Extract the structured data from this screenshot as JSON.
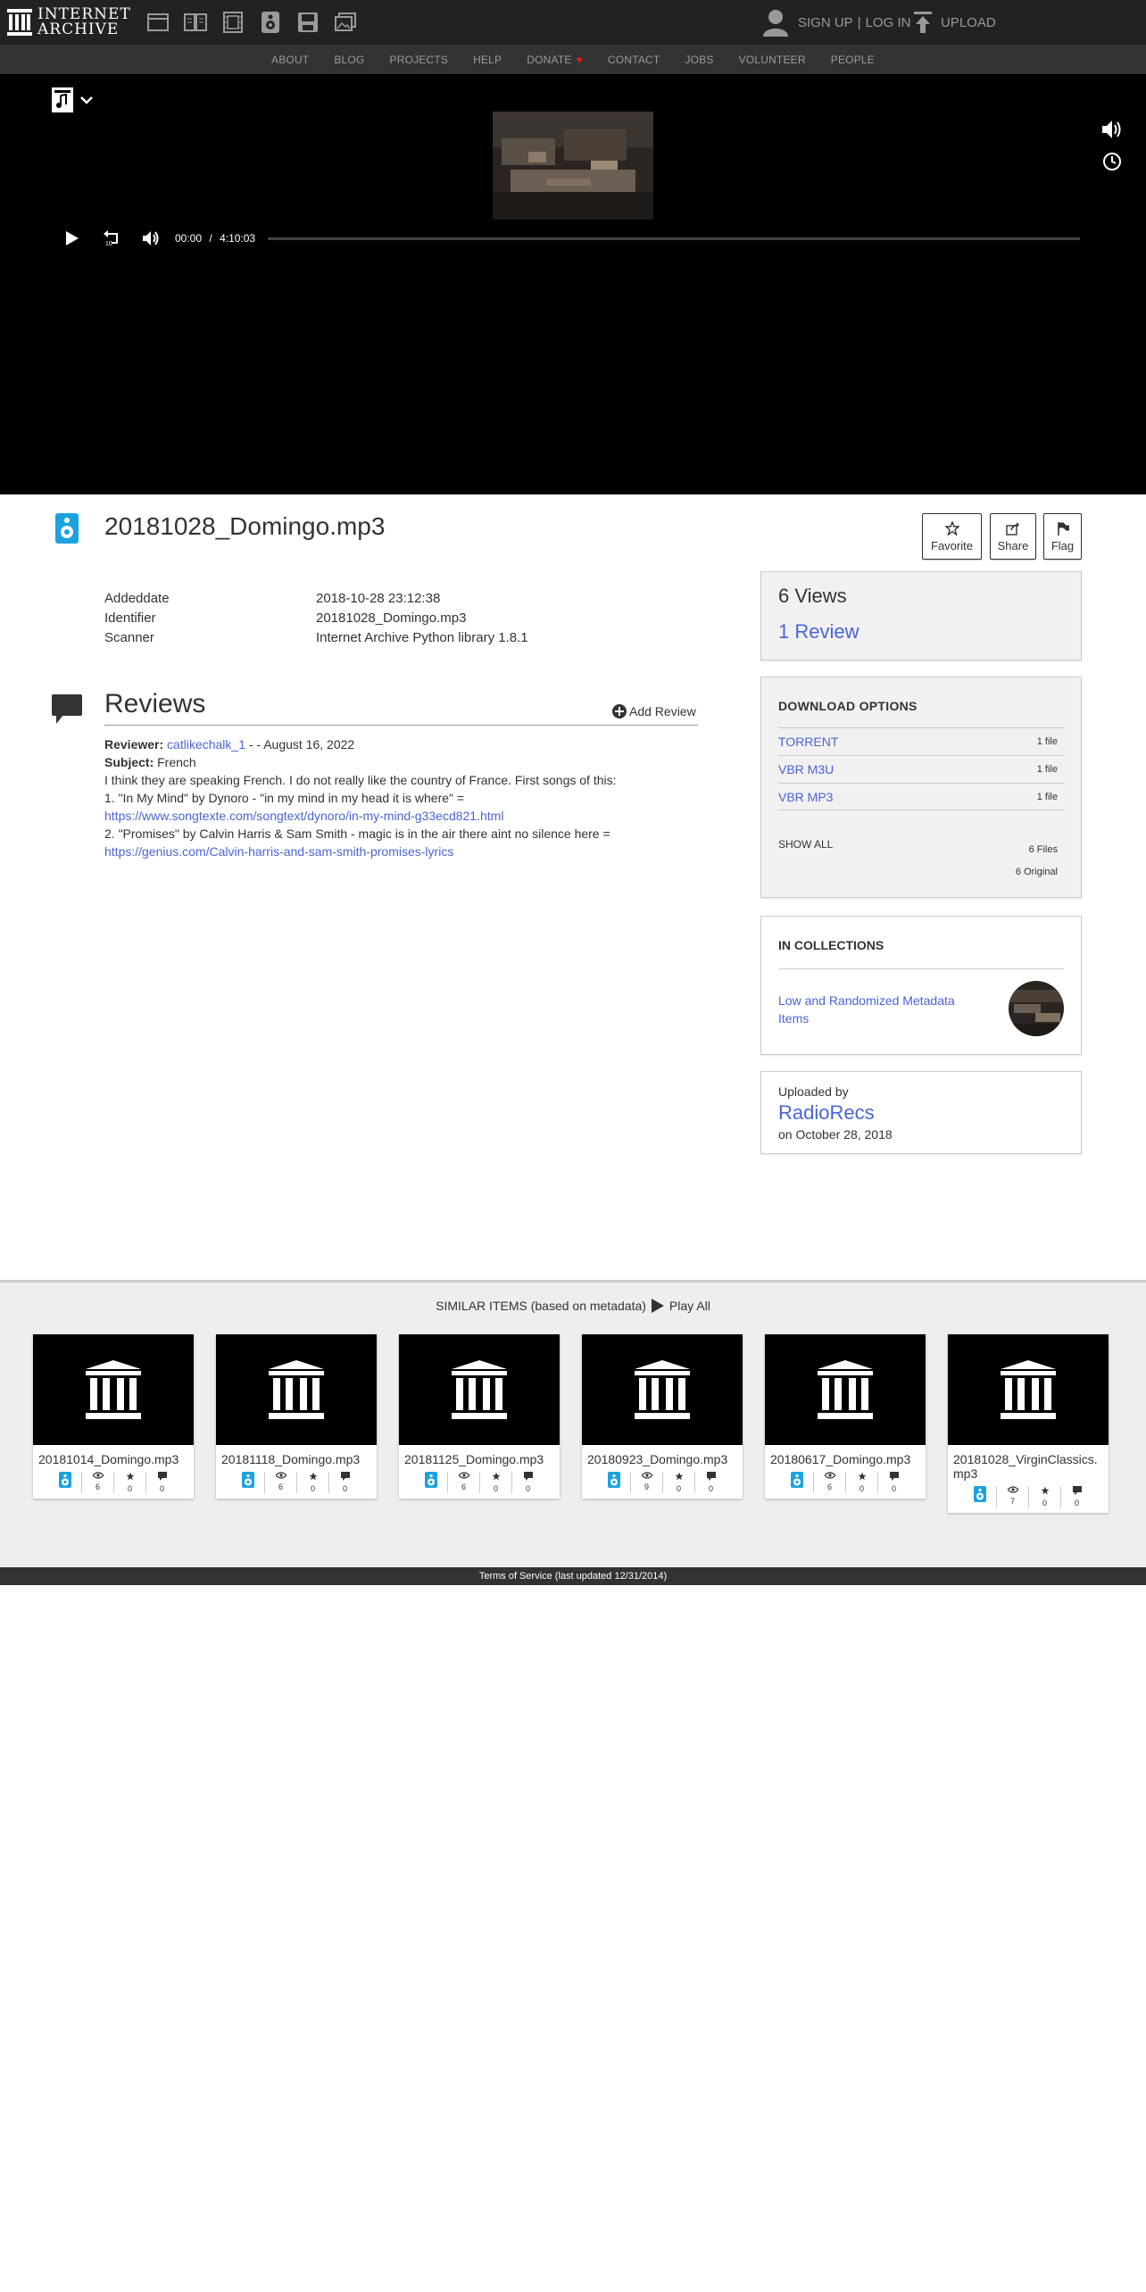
{
  "header": {
    "logo_line1": "INTERNET",
    "logo_line2": "ARCHIVE",
    "media_icons": [
      "web-icon",
      "texts-icon",
      "video-icon",
      "audio-icon",
      "software-icon",
      "images-icon"
    ],
    "signup_label": "SIGN UP",
    "separator": "|",
    "login_label": "LOG IN",
    "upload_label": "UPLOAD"
  },
  "nav": {
    "items": [
      "ABOUT",
      "BLOG",
      "PROJECTS",
      "HELP",
      "DONATE",
      "CONTACT",
      "JOBS",
      "VOLUNTEER",
      "PEOPLE"
    ],
    "donate_heart": "♥"
  },
  "player": {
    "current_time": "00:00",
    "time_separator": "/",
    "duration": "4:10:03"
  },
  "item": {
    "title": "20181028_Domingo.mp3",
    "favorite_label": "Favorite",
    "share_label": "Share",
    "flag_label": "Flag",
    "metadata": [
      {
        "key": "Addeddate",
        "value": "2018-10-28 23:12:38"
      },
      {
        "key": "Identifier",
        "value": "20181028_Domingo.mp3"
      },
      {
        "key": "Scanner",
        "value": "Internet Archive Python library 1.8.1"
      }
    ]
  },
  "reviews": {
    "heading": "Reviews",
    "add_review_label": "Add Review",
    "reviewer_label": "Reviewer:",
    "reviewer_name": "catlikechalk_1",
    "reviewer_sep": " - - ",
    "review_date": "August 16, 2022",
    "subject_label": "Subject:",
    "subject": "French",
    "line1": "I think they are speaking French. I do not really like the country of France. First songs of this:",
    "line2": "1. \"In My Mind\" by Dynoro - \"in my mind in my head it is where\" =",
    "link1": "https://www.songtexte.com/songtext/dynoro/in-my-mind-g33ecd821.html",
    "line3": "2. \"Promises\" by Calvin Harris & Sam Smith - magic is in the air there aint no silence here =",
    "link2": "https://genius.com/Calvin-harris-and-sam-smith-promises-lyrics"
  },
  "stats": {
    "views": "6 Views",
    "reviews": "1 Review"
  },
  "downloads": {
    "title": "DOWNLOAD OPTIONS",
    "rows": [
      {
        "name": "TORRENT",
        "count": "1 file"
      },
      {
        "name": "VBR M3U",
        "count": "1 file"
      },
      {
        "name": "VBR MP3",
        "count": "1 file"
      }
    ],
    "show_all": "SHOW ALL",
    "files": "6 Files",
    "original": "6 Original"
  },
  "collections": {
    "title": "IN COLLECTIONS",
    "item": "Low and Randomized Metadata Items"
  },
  "uploader": {
    "label": "Uploaded by",
    "name": "RadioRecs",
    "date": "on October 28, 2018"
  },
  "similar": {
    "heading": "SIMILAR ITEMS (based on metadata)",
    "play_all": "Play All",
    "items": [
      {
        "title": "20181014_Domingo.mp3",
        "views": "6",
        "favs": "0",
        "reviews": "0"
      },
      {
        "title": "20181118_Domingo.mp3",
        "views": "6",
        "favs": "0",
        "reviews": "0"
      },
      {
        "title": "20181125_Domingo.mp3",
        "views": "6",
        "favs": "0",
        "reviews": "0"
      },
      {
        "title": "20180923_Domingo.mp3",
        "views": "9",
        "favs": "0",
        "reviews": "0"
      },
      {
        "title": "20180617_Domingo.mp3",
        "views": "6",
        "favs": "0",
        "reviews": "0"
      },
      {
        "title": "20181028_VirginClassics.mp3",
        "views": "7",
        "favs": "0",
        "reviews": "0"
      }
    ]
  },
  "footer": {
    "text": "Terms of Service (last updated 12/31/2014)"
  },
  "colors": {
    "topbar": "#222222",
    "navbar": "#333333",
    "link": "#4b64d6",
    "audio_accent": "#1ca2e0",
    "heart": "#e21d1d"
  }
}
